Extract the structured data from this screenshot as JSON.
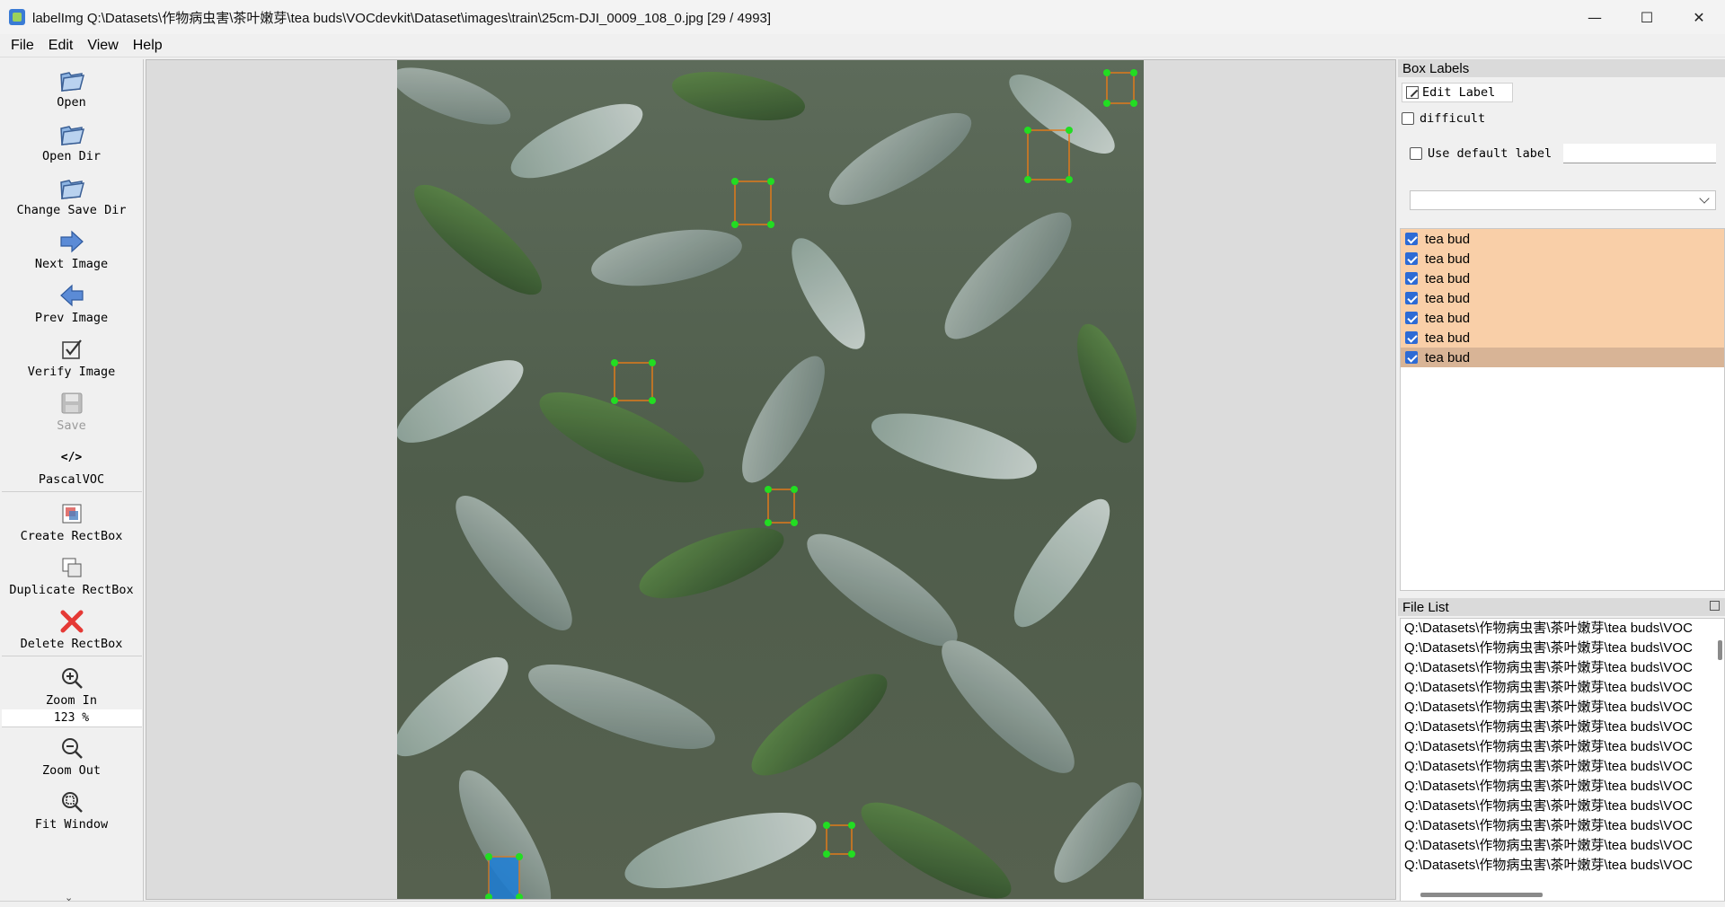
{
  "window": {
    "title": "labelImg Q:\\Datasets\\作物病虫害\\茶叶嫩芽\\tea buds\\VOCdevkit\\Dataset\\images\\train\\25cm-DJI_0009_108_0.jpg [29 / 4993]",
    "minimize": "—",
    "maximize": "☐",
    "close": "✕"
  },
  "menu": [
    "File",
    "Edit",
    "View",
    "Help"
  ],
  "toolbar": {
    "open": "Open",
    "open_dir": "Open Dir",
    "change_save_dir": "Change Save Dir",
    "next_image": "Next Image",
    "prev_image": "Prev Image",
    "verify_image": "Verify Image",
    "save": "Save",
    "format_icon": "</>",
    "format": "PascalVOC",
    "create_rectbox": "Create RectBox",
    "duplicate_rectbox": "Duplicate RectBox",
    "delete_rectbox": "Delete RectBox",
    "zoom_in": "Zoom In",
    "zoom_level": "123 %",
    "zoom_out": "Zoom Out",
    "fit_window": "Fit Window"
  },
  "box_labels": {
    "title": "Box Labels",
    "edit_label": "Edit Label",
    "difficult": "difficult",
    "use_default_label": "Use default label",
    "default_label_value": "",
    "selected_combo": "",
    "labels": [
      {
        "text": "tea bud",
        "checked": true
      },
      {
        "text": "tea bud",
        "checked": true
      },
      {
        "text": "tea bud",
        "checked": true
      },
      {
        "text": "tea bud",
        "checked": true
      },
      {
        "text": "tea bud",
        "checked": true
      },
      {
        "text": "tea bud",
        "checked": true
      },
      {
        "text": "tea bud",
        "checked": true
      }
    ],
    "label_color": "#f9cfa8",
    "selected_color": "#d8b496"
  },
  "file_list": {
    "title": "File List",
    "items": [
      "Q:\\Datasets\\作物病虫害\\茶叶嫩芽\\tea buds\\VOC",
      "Q:\\Datasets\\作物病虫害\\茶叶嫩芽\\tea buds\\VOC",
      "Q:\\Datasets\\作物病虫害\\茶叶嫩芽\\tea buds\\VOC",
      "Q:\\Datasets\\作物病虫害\\茶叶嫩芽\\tea buds\\VOC",
      "Q:\\Datasets\\作物病虫害\\茶叶嫩芽\\tea buds\\VOC",
      "Q:\\Datasets\\作物病虫害\\茶叶嫩芽\\tea buds\\VOC",
      "Q:\\Datasets\\作物病虫害\\茶叶嫩芽\\tea buds\\VOC",
      "Q:\\Datasets\\作物病虫害\\茶叶嫩芽\\tea buds\\VOC",
      "Q:\\Datasets\\作物病虫害\\茶叶嫩芽\\tea buds\\VOC",
      "Q:\\Datasets\\作物病虫害\\茶叶嫩芽\\tea buds\\VOC",
      "Q:\\Datasets\\作物病虫害\\茶叶嫩芽\\tea buds\\VOC",
      "Q:\\Datasets\\作物病虫害\\茶叶嫩芽\\tea buds\\VOC",
      "Q:\\Datasets\\作物病虫害\\茶叶嫩芽\\tea buds\\VOC"
    ]
  },
  "colors": {
    "box_vertex": "#22dd22",
    "box_edge": "#e07a1a",
    "selected_fill": "#1e7fd8",
    "accent": "#2d6bd5"
  }
}
